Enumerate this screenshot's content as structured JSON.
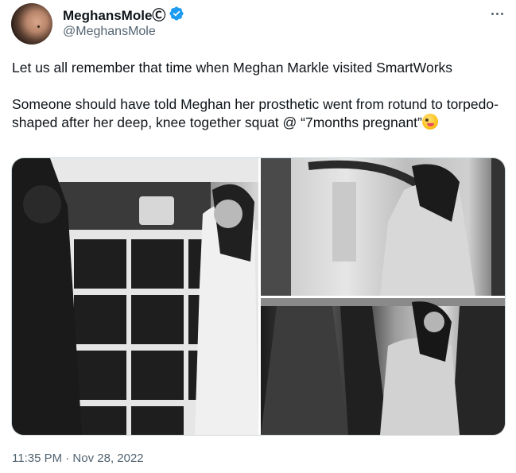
{
  "author": {
    "display_name": "MeghansMoleⒸ",
    "handle": "@MeghansMole",
    "verified": true,
    "avatar_icon": "avatar-photo",
    "verified_color": "#1d9bf0"
  },
  "menu": {
    "icon": "more-horizontal-icon"
  },
  "tweet": {
    "paragraph_1": "Let us all remember that time when Meghan Markle visited SmartWorks",
    "paragraph_2": "Someone should have told Meghan her prosthetic went from rotund to torpedo-shaped after her deep, knee together squat @ “7months pregnant”",
    "emoji": "zany-face-emoji"
  },
  "media": {
    "photos": [
      {
        "icon": "photo-shelves-meeting"
      },
      {
        "icon": "photo-reaching-rack"
      },
      {
        "icon": "photo-browsing-clothes"
      }
    ]
  },
  "timestamp": "11:35 PM · Nov 28, 2022"
}
